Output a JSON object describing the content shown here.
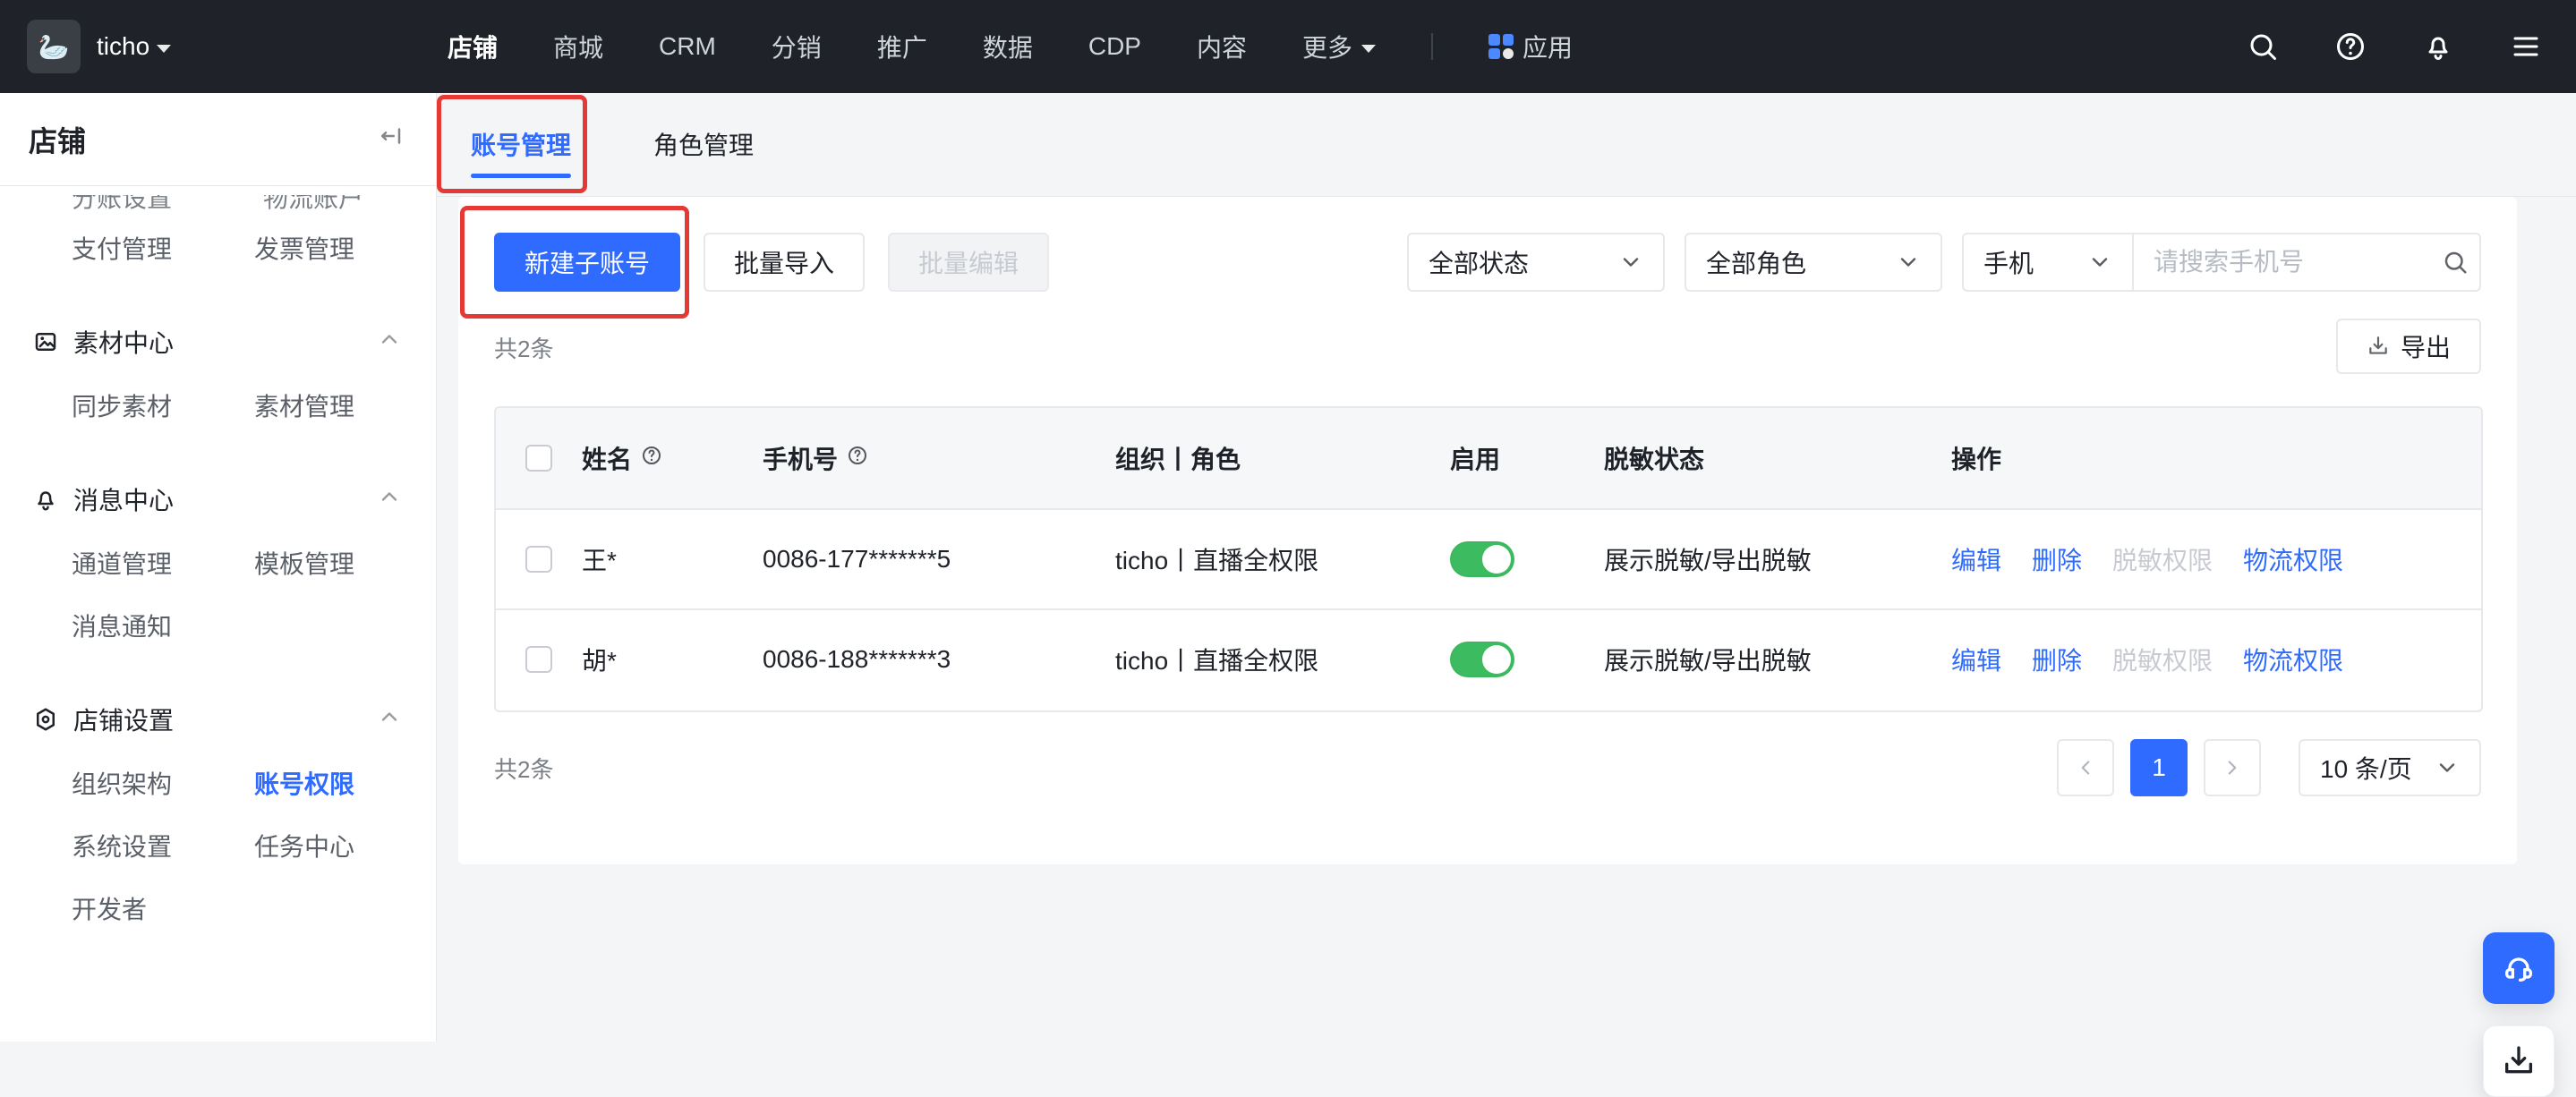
{
  "topbar": {
    "brand_name": "ticho",
    "nav": [
      "店铺",
      "商城",
      "CRM",
      "分销",
      "推广",
      "数据",
      "CDP",
      "内容",
      "更多",
      "应用"
    ]
  },
  "sidebar": {
    "title": "店铺",
    "cutoff": {
      "left": "分账设置",
      "right": "物流账户"
    },
    "top_links": {
      "left": "支付管理",
      "right": "发票管理"
    },
    "groups": [
      {
        "title": "素材中心",
        "links": [
          [
            "同步素材",
            "素材管理"
          ]
        ]
      },
      {
        "title": "消息中心",
        "links": [
          [
            "通道管理",
            "模板管理"
          ],
          [
            "消息通知",
            ""
          ]
        ]
      },
      {
        "title": "店铺设置",
        "links": [
          [
            "组织架构",
            "账号权限"
          ],
          [
            "系统设置",
            "任务中心"
          ],
          [
            "开发者",
            ""
          ]
        ]
      }
    ]
  },
  "tabs": [
    "账号管理",
    "角色管理"
  ],
  "toolbar": {
    "new_sub_account": "新建子账号",
    "bulk_import": "批量导入",
    "bulk_edit": "批量编辑",
    "filter_status": "全部状态",
    "filter_role": "全部角色",
    "search_type": "手机",
    "search_placeholder": "请搜索手机号"
  },
  "summary_top": "共2条",
  "export_label": "导出",
  "table": {
    "headers": [
      "姓名",
      "手机号",
      "组织丨角色",
      "启用",
      "脱敏状态",
      "操作"
    ],
    "rows": [
      {
        "name": "王*",
        "phone": "0086-177*******5",
        "org_role": "ticho丨直播全权限",
        "enabled": true,
        "mask_status": "展示脱敏/导出脱敏",
        "ops": [
          "编辑",
          "删除",
          "脱敏权限",
          "物流权限"
        ]
      },
      {
        "name": "胡*",
        "phone": "0086-188*******3",
        "org_role": "ticho丨直播全权限",
        "enabled": true,
        "mask_status": "展示脱敏/导出脱敏",
        "ops": [
          "编辑",
          "删除",
          "脱敏权限",
          "物流权限"
        ]
      }
    ]
  },
  "summary_bottom": "共2条",
  "pagination": {
    "current_page": "1",
    "page_size": "10 条/页"
  },
  "colors": {
    "primary": "#2f6bff",
    "topbar": "#1f2329",
    "switch_on": "#3dbb61",
    "highlight": "#e53935"
  }
}
